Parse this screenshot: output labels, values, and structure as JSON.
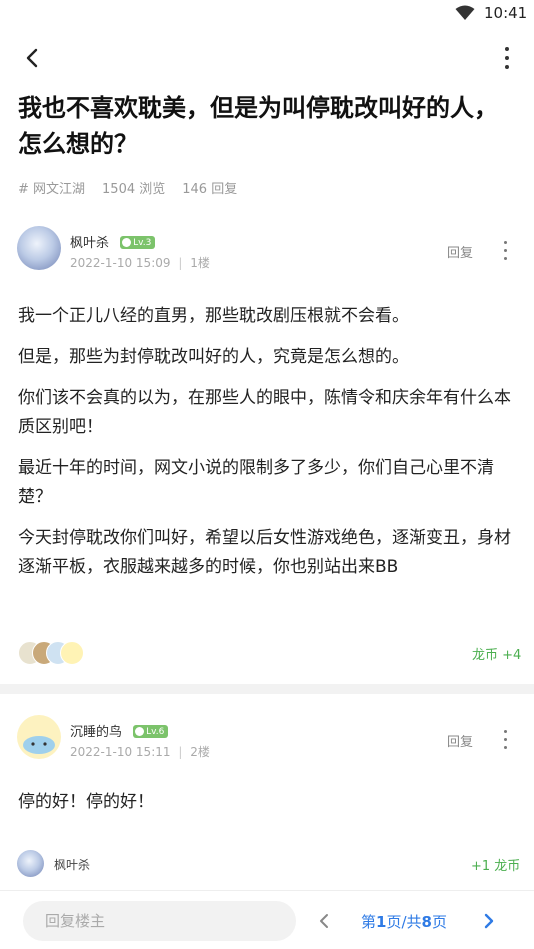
{
  "status_bar": {
    "time": "10:41"
  },
  "post": {
    "title": "我也不喜欢耽美，但是为叫停耽改叫好的人，怎么想的？",
    "tag": "# 网文江湖",
    "views": "1504 浏览",
    "replies": "146 回复",
    "author": {
      "name": "枫叶杀",
      "level": "Lv.3",
      "datetime": "2022-1-10 15:09",
      "floor": "1楼"
    },
    "reply_label": "回复",
    "paragraphs": [
      "我一个正儿八经的直男，那些耽改剧压根就不会看。",
      "但是，那些为封停耽改叫好的人，究竟是怎么想的。",
      "你们该不会真的以为，在那些人的眼中，陈情令和庆余年有什么本质区别吧！",
      "最近十年的时间，网文小说的限制多了多少，你们自己心里不清楚？",
      "今天封停耽改你们叫好，希望以后女性游戏绝色，逐渐变丑，身材逐渐平板，衣服越来越多的时候，你也别站出来BB"
    ],
    "coin_reward": "龙币 +4"
  },
  "floor2": {
    "author": {
      "name": "沉睡的鸟",
      "level": "Lv.6",
      "datetime": "2022-1-10 15:11",
      "floor": "2楼"
    },
    "reply_label": "回复",
    "body": "停的好！停的好！",
    "sub": {
      "user": "枫叶杀",
      "coin": "+1 龙币"
    }
  },
  "bottom_bar": {
    "reply_placeholder": "回复楼主",
    "page_prefix": "第",
    "page_current": "1",
    "page_middle": "页/共",
    "page_total": "8",
    "page_suffix": "页"
  },
  "colors": {
    "accent_blue": "#2f7be5",
    "coin_green": "#4caf50",
    "level_green": "#7cc36b"
  },
  "icons": [
    "wifi-icon",
    "back-arrow-icon",
    "more-vertical-icon",
    "chevron-left-icon",
    "chevron-right-icon"
  ]
}
